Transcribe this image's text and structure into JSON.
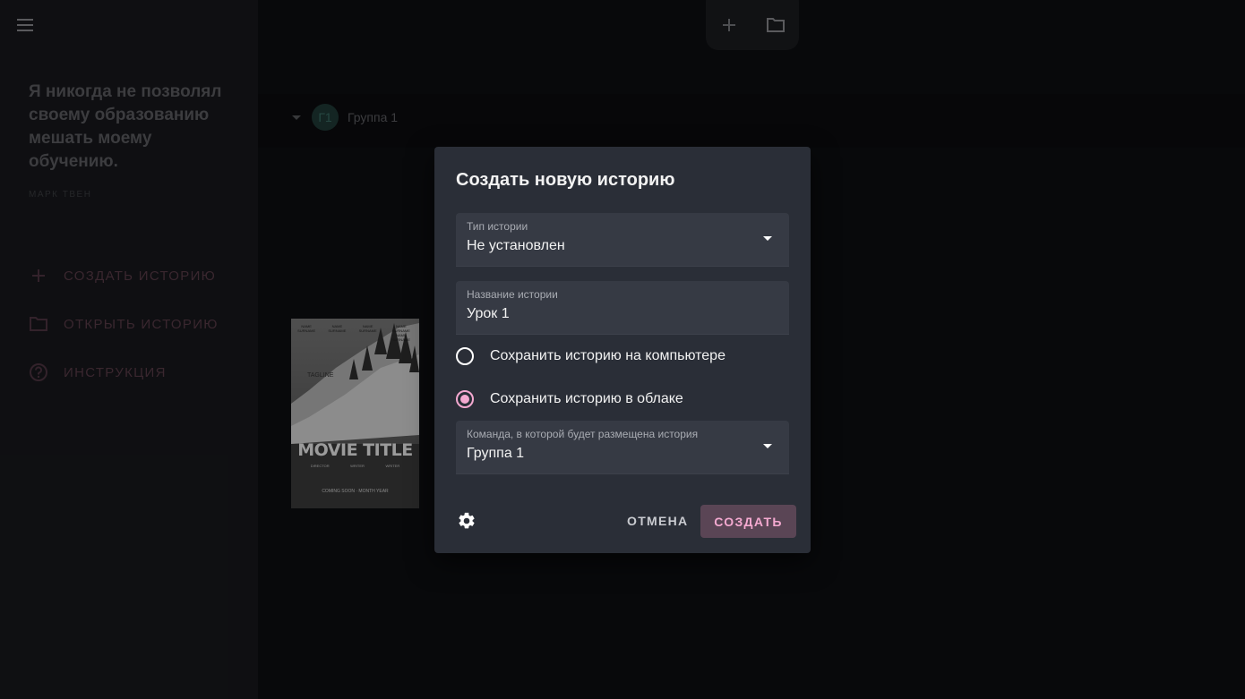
{
  "sidebar": {
    "quote": "Я никогда не позволял своему образованию мешать моему обучению.",
    "quote_author": "МАРК ТВЕН",
    "items": [
      {
        "label": "СОЗДАТЬ ИСТОРИЮ",
        "icon": "plus-icon"
      },
      {
        "label": "ОТКРЫТЬ ИСТОРИЮ",
        "icon": "folder-icon"
      },
      {
        "label": "ИНСТРУКЦИЯ",
        "icon": "help-circle-icon"
      }
    ]
  },
  "toolbar": {
    "add_icon": "plus-icon",
    "open_icon": "folder-icon"
  },
  "group": {
    "avatar_text": "Г1",
    "name": "Группа 1"
  },
  "poster": {
    "names": [
      "NAME SURNAME",
      "NAME SURNAME",
      "NAME SURNAME",
      "NAME SURNAME NAME SURNAME"
    ],
    "tagline": "TAGLINE",
    "title": "MOVIE TITLE",
    "credits": [
      "DIRECTOR",
      "WRITER",
      "WRITER"
    ],
    "coming": "COMING SOON · MONTH YEAR"
  },
  "dialog": {
    "title": "Создать новую историю",
    "type_field": {
      "label": "Тип истории",
      "value": "Не установлен"
    },
    "name_field": {
      "label": "Название истории",
      "value": "Урок 1"
    },
    "radio_local": {
      "label": "Сохранить историю на компьютере",
      "checked": false
    },
    "radio_cloud": {
      "label": "Сохранить историю в облаке",
      "checked": true
    },
    "team_field": {
      "label": "Команда, в которой будет размещена история",
      "value": "Группа 1"
    },
    "cancel_label": "ОТМЕНА",
    "create_label": "СОЗДАТЬ"
  },
  "colors": {
    "accent": "#f4a9d0",
    "dialog_bg": "#2a2e37",
    "field_bg": "#363a44",
    "sidebar_bg": "#17181c"
  }
}
